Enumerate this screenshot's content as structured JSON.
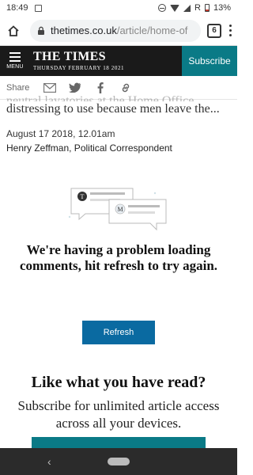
{
  "status_bar": {
    "time": "18:49",
    "battery": "13%",
    "network": "R"
  },
  "browser": {
    "url_domain": "thetimes.co.uk",
    "url_path": "/article/home-of",
    "tab_count": "6"
  },
  "masthead": {
    "menu_label": "MENU",
    "logo_name": "THE TIMES",
    "logo_date": "THURSDAY FEBRUARY 18 2021",
    "subscribe_label": "Subscribe",
    "accent": "#0a7a86"
  },
  "share": {
    "label": "Share",
    "icons": [
      "email-icon",
      "twitter-icon",
      "facebook-icon",
      "link-icon"
    ]
  },
  "article": {
    "headline_ghost": "neutral lavatories at the Home Office",
    "headline_line": "distressing to use because men leave the...",
    "date": "August 17 2018, 12.01am",
    "author": "Henry Zeffman, Political Correspondent"
  },
  "comments": {
    "error_message": "We're having a problem loading comments, hit refresh to try again.",
    "refresh_label": "Refresh",
    "avatar_letters": [
      "T",
      "M"
    ],
    "button_color": "#0a6aa1"
  },
  "promo": {
    "title": "Like what you have read?",
    "subtitle": "Subscribe for unlimited article access across all your devices."
  }
}
